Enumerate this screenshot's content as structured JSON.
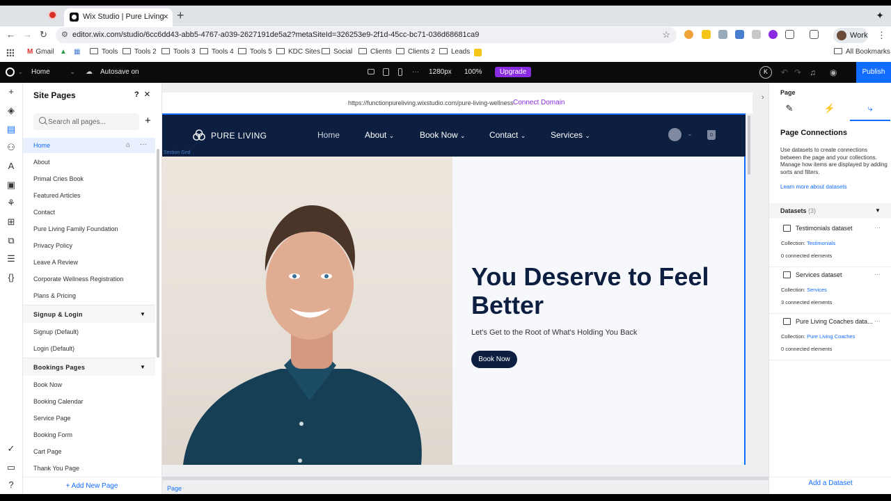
{
  "browser": {
    "tab_title": "Wix Studio | Pure Living",
    "url": "editor.wix.com/studio/6cc6dd43-abb5-4767-a039-2627191de5a2?metaSiteId=326253e9-2f1d-45cc-bc71-036d68681ca9",
    "profile_label": "Work",
    "bookmarks": [
      "Gmail",
      "Tools",
      "Tools 2",
      "Tools 3",
      "Tools 4",
      "Tools 5",
      "KDC Sites",
      "Social",
      "Clients",
      "Clients 2",
      "Leads"
    ],
    "all_bookmarks": "All Bookmarks"
  },
  "editor": {
    "page_selector": "Home",
    "autosave": "Autosave on",
    "breakpoint": "1280px",
    "zoom": "100%",
    "upgrade_label": "Upgrade",
    "avatar_letter": "K",
    "publish_label": "Publish"
  },
  "site_pages": {
    "title": "Site Pages",
    "help": "?",
    "search_placeholder": "Search all pages...",
    "pages": [
      "Home",
      "About",
      "Primal Cries Book",
      "Featured Articles",
      "Contact",
      "Pure Living Family Foundation",
      "Privacy Policy",
      "Leave A Review",
      "Corporate Wellness Registration",
      "Plans & Pricing"
    ],
    "signup_section": "Signup & Login",
    "signup_pages": [
      "Signup (Default)",
      "Login (Default)"
    ],
    "bookings_section": "Bookings Pages",
    "bookings_pages": [
      "Book Now",
      "Booking Calendar",
      "Service Page",
      "Booking Form",
      "Cart Page",
      "Thank You Page"
    ],
    "add_new": "+ Add New Page"
  },
  "canvas": {
    "site_url": "https://functionpureliving.wixstudio.com/pure-living-wellness",
    "connect_domain": "Connect Domain",
    "brand": "PURE LIVING",
    "nav": [
      "Home",
      "About",
      "Book Now",
      "Contact",
      "Services"
    ],
    "cart_count": "0",
    "grid_tag": "Section Grid",
    "hero_heading": "You Deserve to Feel Better",
    "hero_sub": "Let's Get to the Root of What's Holding You Back",
    "hero_button": "Book Now",
    "page_tag": "Page"
  },
  "right_panel": {
    "title": "Page",
    "heading": "Page Connections",
    "description": "Use datasets to create connections between the page and your collections. Manage how items are displayed by adding sorts and filters.",
    "learn_more": "Learn more about datasets",
    "datasets_label": "Datasets",
    "datasets_count": "(3)",
    "collection_label": "Collection:",
    "datasets": [
      {
        "name": "Testimonials dataset",
        "collection": "Testimonials",
        "connected": "0 connected elements"
      },
      {
        "name": "Services dataset",
        "collection": "Services",
        "connected": "3 connected elements"
      },
      {
        "name": "Pure Living Coaches data...",
        "collection": "Pure Living Coaches",
        "connected": "0 connected elements"
      }
    ],
    "add_dataset": "Add a Dataset"
  },
  "colors": {
    "accent": "#116dff",
    "site_navy": "#0d1f40",
    "upgrade": "#8a2be2"
  }
}
